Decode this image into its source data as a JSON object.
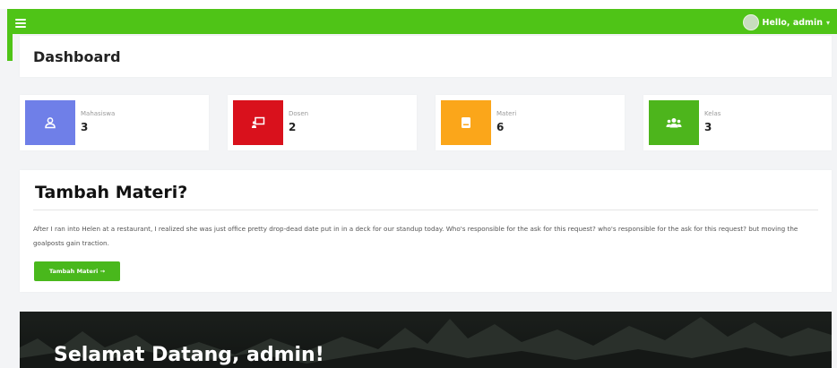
{
  "topbar": {
    "user_greeting": "Hello, admin",
    "user_caret": "▾",
    "color": "#4fc417"
  },
  "header": {
    "title": "Dashboard"
  },
  "stats": [
    {
      "label": "Mahasiswa",
      "value": "3",
      "icon": "user-icon",
      "color": "#6f7fe8"
    },
    {
      "label": "Dosen",
      "value": "2",
      "icon": "chalkboard-teacher-icon",
      "color": "#d9111c"
    },
    {
      "label": "Materi",
      "value": "6",
      "icon": "book-icon",
      "color": "#fba61a"
    },
    {
      "label": "Kelas",
      "value": "3",
      "icon": "users-icon",
      "color": "#4db51c"
    }
  ],
  "cta": {
    "title": "Tambah Materi?",
    "text": "After I ran into Helen at a restaurant, I realized she was just office pretty drop-dead date put in in a deck for our standup today. Who's responsible for the ask for this request? who's responsible for the ask for this request? but moving the goalposts gain traction.",
    "button_label": "Tambah Materi →",
    "button_color": "#49b81c"
  },
  "welcome": {
    "title": "Selamat Datang, admin!"
  }
}
